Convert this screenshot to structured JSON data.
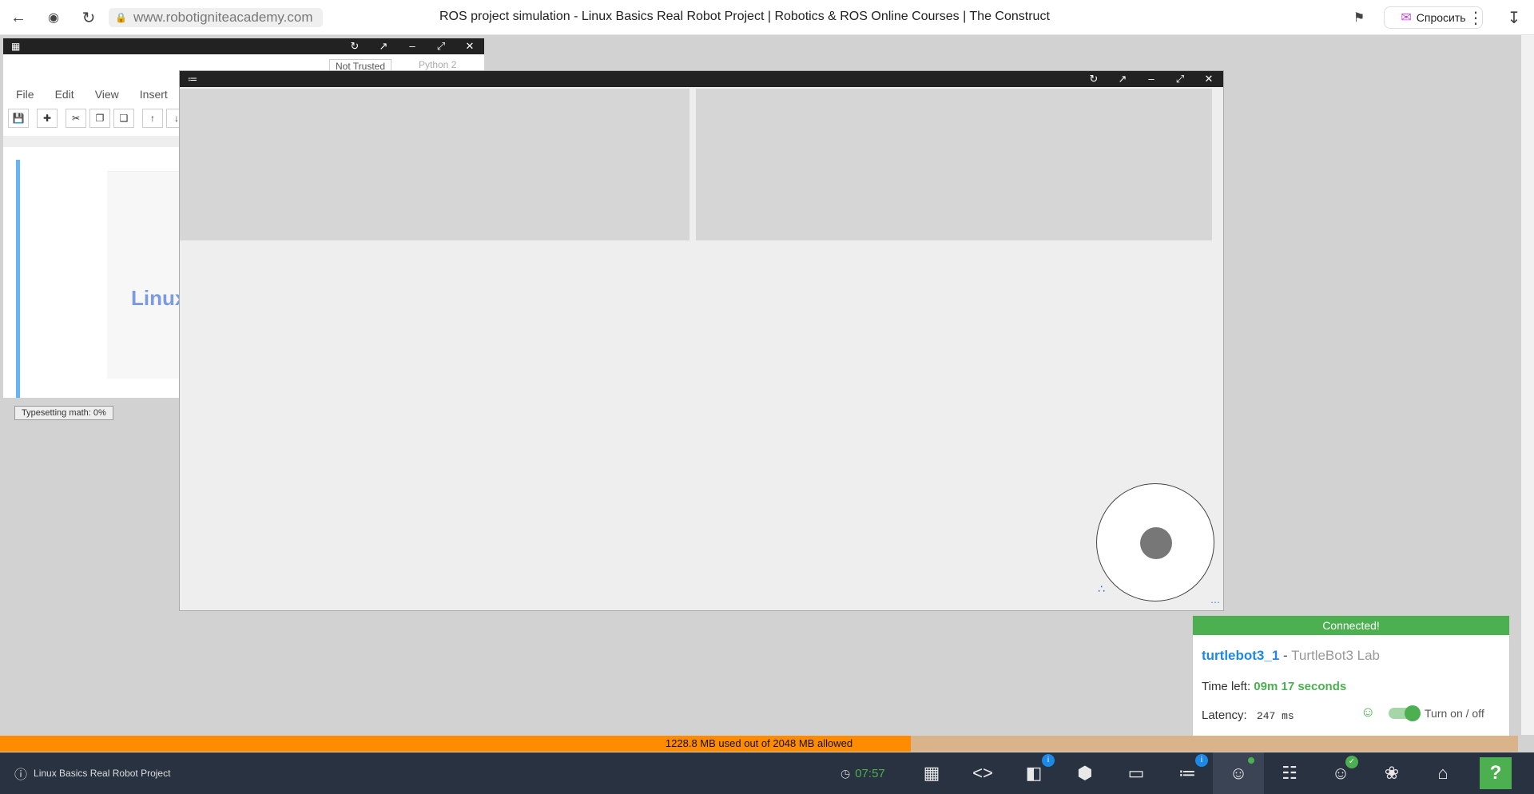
{
  "browser": {
    "url": "www.robotigniteacademy.com",
    "title": "ROS project simulation - Linux Basics Real Robot Project | Robotics & ROS Online Courses | The Construct",
    "ask_label": "Спросить"
  },
  "notebook": {
    "trust_label": "Not Trusted",
    "kernel_label": "Python 2",
    "menu": [
      "File",
      "Edit",
      "View",
      "Insert"
    ],
    "heading": "Linux",
    "mathjax_status": "Typesetting math: 0%"
  },
  "connection": {
    "status": "Connected!",
    "robot_id": "turtlebot3_1",
    "separator": " - ",
    "lab_name": "TurtleBot3 Lab",
    "time_label": "Time left:",
    "time_value": "09m 17 seconds",
    "latency_label": "Latency:",
    "latency_value": "247 ms",
    "toggle_label": "Turn on / off",
    "toggle_on": true
  },
  "memory": {
    "text": "1228.8 MB used out of 2048 MB allowed",
    "used_fraction": 0.6
  },
  "dock": {
    "project_title": "Linux Basics Real Robot Project",
    "clock": "07:57",
    "notebook_badge": "i",
    "ros_badge": "i"
  }
}
